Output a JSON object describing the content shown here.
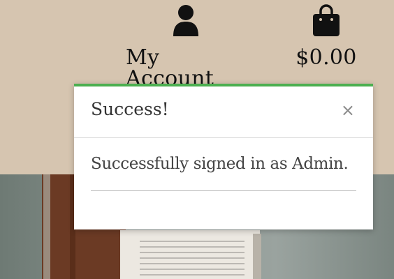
{
  "nav": {
    "account": {
      "label": "My Account",
      "icon": "user-icon"
    },
    "bag": {
      "label": "$0.00",
      "icon": "shopping-bag-icon"
    }
  },
  "toast": {
    "title": "Success!",
    "close": "×",
    "message": "Successfully signed in as Admin.",
    "accent_color": "#4caf50"
  },
  "colors": {
    "header_bg": "#d6c5b0",
    "toast_bg": "#ffffff"
  }
}
